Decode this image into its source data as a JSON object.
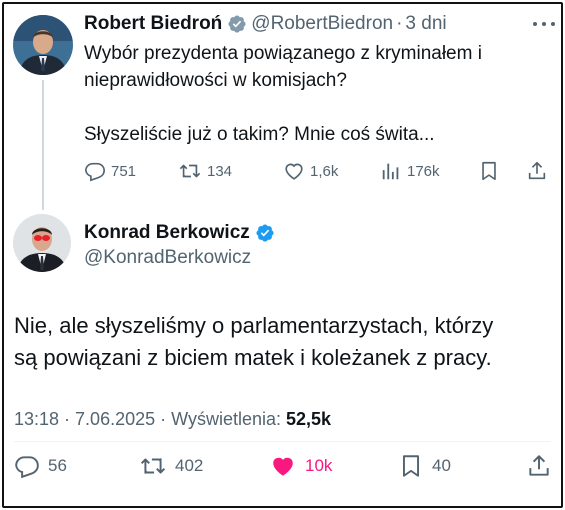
{
  "parent_tweet": {
    "author_name": "Robert Biedroń",
    "handle": "@RobertBiedron",
    "separator": "·",
    "time": "3 dni",
    "lines": [
      "Wybór prezydenta powiązanego z kryminałem i",
      "nieprawidłowości w komisjach?",
      "",
      "Słyszeliście już o takim? Mnie coś świta..."
    ],
    "replies": "751",
    "retweets": "134",
    "likes": "1,6k",
    "views": "176k"
  },
  "main_tweet": {
    "author_name": "Konrad Berkowicz",
    "handle": "@KonradBerkowicz",
    "lines": [
      "Nie, ale słyszeliśmy o parlamentarzystach, którzy",
      "są powiązani z biciem matek i koleżanek z pracy."
    ],
    "timestamp": "13:18 · 7.06.2025 · Wyświetlenia:",
    "views": "52,5k",
    "replies": "56",
    "retweets": "402",
    "likes": "10k",
    "bookmarks": "40"
  },
  "colors": {
    "verified": "#1d9bf0",
    "like_active": "#f91880",
    "secondary_text": "#536471",
    "primary_text": "#0f1419",
    "thread_line": "#cfd9de"
  },
  "icons": [
    "verified-badge-icon",
    "more-icon",
    "reply-icon",
    "retweet-icon",
    "like-icon",
    "views-icon",
    "bookmark-icon",
    "share-icon"
  ]
}
